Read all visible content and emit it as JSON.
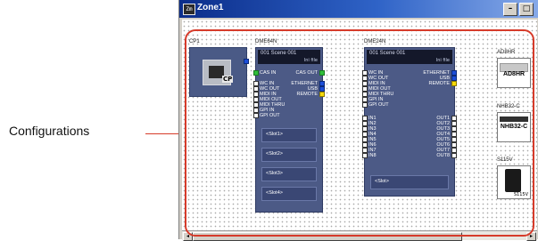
{
  "callout": {
    "text": "Configurations",
    "color": "#d63b2a"
  },
  "window": {
    "icon_text": "Zm",
    "title": "Zone1",
    "buttons": {
      "minimize": "–",
      "maximize": "□"
    }
  },
  "devices": {
    "cp1": {
      "label": "CP1",
      "tag": "CP"
    },
    "dme64n": {
      "label": "DME64N",
      "scene": "001 Scene 001",
      "tag": "Ini file",
      "ports_left": [
        "CAS IN",
        "WC IN",
        "WC OUT",
        "MIDI IN",
        "MIDI OUT",
        "MIDI THRU",
        "GPI IN",
        "GPI OUT"
      ],
      "ports_right": [
        "CAS OUT",
        "ETHERNET",
        "USB",
        "REMOTE"
      ],
      "slots": [
        "<Slot1>",
        "<Slot2>",
        "<Slot3>",
        "<Slot4>"
      ]
    },
    "dme24n": {
      "label": "DME24N",
      "scene": "001 Scene 001",
      "tag": "Ini file",
      "ports_left": [
        "WC IN",
        "WC OUT",
        "MIDI IN",
        "MIDI OUT",
        "MIDI THRU",
        "GPI IN",
        "GPI OUT"
      ],
      "ports_right": [
        "ETHERNET",
        "USB",
        "REMOTE"
      ],
      "inputs": [
        "IN1",
        "IN2",
        "IN3",
        "IN4",
        "IN5",
        "IN6",
        "IN7",
        "IN8"
      ],
      "outputs": [
        "OUT1",
        "OUT2",
        "OUT3",
        "OUT4",
        "OUT5",
        "OUT6",
        "OUT7",
        "OUT8"
      ],
      "slot": "<Slot>"
    },
    "ad8hr": {
      "label": "AD8HR",
      "text": "AD8HR"
    },
    "nhb32c": {
      "label": "NHB32-C",
      "text": "NHB32-C"
    },
    "s115v": {
      "label": "S115V",
      "tag": "S115V"
    }
  }
}
